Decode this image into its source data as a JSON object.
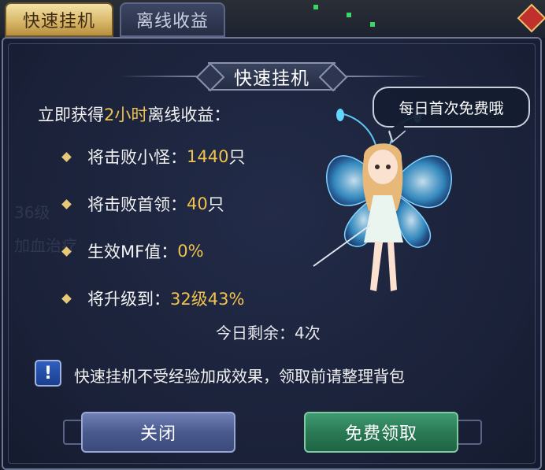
{
  "tabs": [
    {
      "label": "快速挂机",
      "active": true
    },
    {
      "label": "离线收益",
      "active": false
    }
  ],
  "dialog": {
    "title": "快速挂机",
    "intro": {
      "prefix": "立即获得",
      "highlight": "2小时",
      "suffix": "离线收益："
    },
    "rows": [
      {
        "label": "将击败小怪：",
        "value": "1440",
        "unit": "只"
      },
      {
        "label": "将击败首领：",
        "value": "40",
        "unit": "只"
      },
      {
        "label": "生效MF值：",
        "value": "0%",
        "unit": ""
      },
      {
        "label": "将升级到：",
        "value": "32级43%",
        "unit": ""
      }
    ],
    "remaining": "今日剩余：4次",
    "notice": "快速挂机不受经验加成效果，领取前请整理背包",
    "notice_icon": "!",
    "bubble": "每日首次免费哦",
    "buttons": {
      "close": "关闭",
      "claim": "免费领取"
    }
  },
  "background_ghost_text": [
    "36级",
    "加血治疗"
  ],
  "colors": {
    "highlight": "#f0c24e",
    "panel_bg": "#1a2138",
    "tab_active": "#d9b86a",
    "close_button": "#4a5a8e",
    "claim_button": "#2b7a55"
  },
  "icons": [
    "exclamation-icon",
    "diamond-bullet-icon",
    "fairy-character"
  ]
}
